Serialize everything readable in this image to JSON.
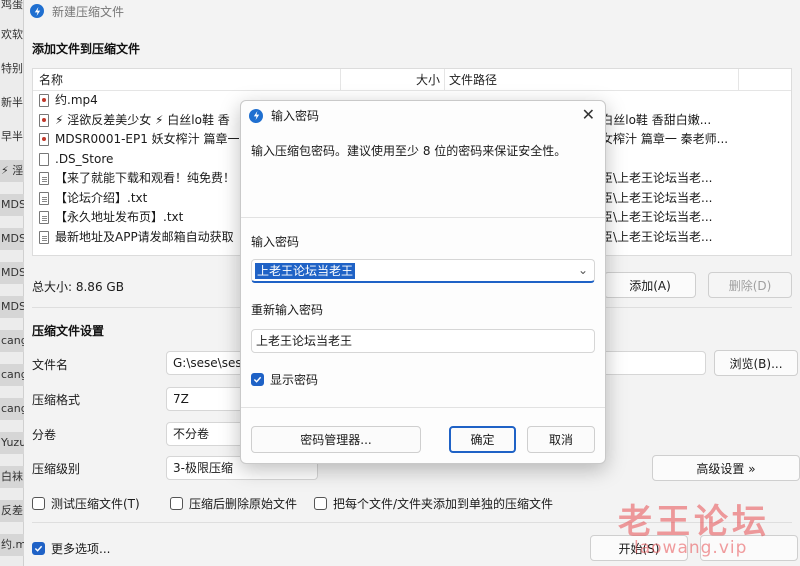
{
  "background_app": {
    "sliver_labels": [
      "鸡蛋",
      "欢软",
      "特别",
      "新半",
      "早半",
      "⚡ 淫",
      "MDS",
      "MDS",
      "MDS",
      "MDS",
      "cang",
      "cang",
      "cang",
      "Yuzu",
      "白袜",
      "反差",
      "约.m"
    ]
  },
  "window": {
    "title": "新建压缩文件",
    "add_section_title": "添加文件到压缩文件",
    "columns": {
      "name": "名称",
      "size": "大小",
      "path": "文件路径"
    },
    "files": [
      {
        "name": "约.mp4",
        "path": "",
        "icon": "media"
      },
      {
        "name": "⚡ 淫欲反差美少女 ⚡ 白丝lo鞋 香",
        "path": "⚡ 白丝lo鞋 香甜白嫩...",
        "icon": "media"
      },
      {
        "name": "MDSR0001-EP1 妖女榨汁 篇章一",
        "path": "妖女榨汁 篇章一 秦老师...",
        "icon": "media"
      },
      {
        "name": ".DS_Store",
        "path": "",
        "icon": "file"
      },
      {
        "name": "【来了就能下载和观看！纯免费！",
        "path": "加臣\\上老王论坛当老...",
        "icon": "txt"
      },
      {
        "name": "【论坛介绍】.txt",
        "path": "加臣\\上老王论坛当老...",
        "icon": "txt"
      },
      {
        "name": "【永久地址发布页】.txt",
        "path": "加臣\\上老王论坛当老...",
        "icon": "txt"
      },
      {
        "name": "最新地址及APP请发邮箱自动获取",
        "path": "加臣\\上老王论坛当老...",
        "icon": "txt"
      }
    ],
    "total_size": "总大小: 8.86 GB",
    "add_button": "添加(A)",
    "delete_button": "删除(D)",
    "settings_title": "压缩文件设置",
    "filename_label": "文件名",
    "filename_value": "G:\\sese\\sese",
    "browse_button": "浏览(B)...",
    "format_label": "压缩格式",
    "format_value": "7Z",
    "split_label": "分卷",
    "split_value": "不分卷",
    "level_label": "压缩级别",
    "level_value": "3-极限压缩",
    "advanced_button": "高级设置 »",
    "test_check": "测试压缩文件(T)",
    "delete_after_check": "压缩后删除原始文件",
    "separate_check": "把每个文件/文件夹添加到单独的压缩文件",
    "more_options": "更多选项...",
    "start_button": "开始(S)"
  },
  "dialog": {
    "title": "输入密码",
    "description": "输入压缩包密码。建议使用至少 8 位的密码来保证安全性。",
    "password_label": "输入密码",
    "password_value": "上老王论坛当老王",
    "reenter_label": "重新输入密码",
    "reenter_value": "上老王论坛当老王",
    "show_password": "显示密码",
    "manager_button": "密码管理器...",
    "ok_button": "确定",
    "cancel_button": "取消"
  },
  "watermark": {
    "line1": "老王论坛",
    "line2": "laowang.vip"
  },
  "colors": {
    "accent": "#1f62c6",
    "watermark": "#e74c50"
  }
}
